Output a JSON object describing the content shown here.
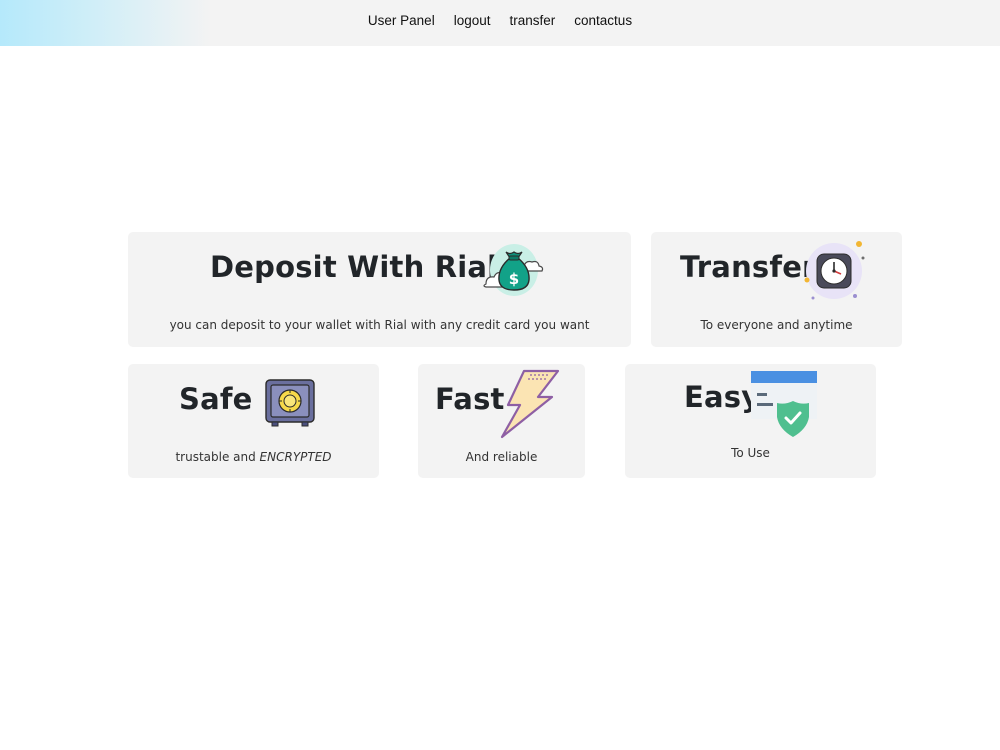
{
  "nav": {
    "items": [
      "User Panel",
      "logout",
      "transfer",
      "contactus"
    ]
  },
  "cards": {
    "deposit": {
      "title": "Deposit With Rial",
      "subtitle": "you can deposit to your wallet with Rial with any credit card you want"
    },
    "transfer": {
      "title": "Transfer",
      "subtitle": "To everyone and anytime"
    },
    "safe": {
      "title": "Safe",
      "subtitle_plain": "trustable and ",
      "subtitle_em": "ENCRYPTED"
    },
    "fast": {
      "title": "Fast",
      "subtitle": "And reliable"
    },
    "easy": {
      "title": "Easy",
      "subtitle": "To Use"
    }
  },
  "icons": {
    "deposit": "money-bag-icon",
    "transfer": "clock-icon",
    "safe": "safe-vault-icon",
    "fast": "lightning-icon",
    "easy": "secure-card-icon"
  },
  "colors": {
    "nav_gradient_start": "#b5e9fb",
    "nav_background": "#f3f3f3",
    "card_background": "#f3f3f3",
    "text": "#212529"
  }
}
